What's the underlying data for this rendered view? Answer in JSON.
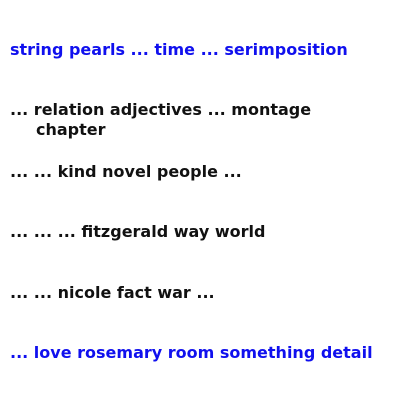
{
  "lines": [
    {
      "text": "string pearls ... time ... serimposition",
      "color": "#1010ee"
    },
    {
      "text": "... relation adjectives ... montage chapter",
      "color": "#111111"
    },
    {
      "text": "... ... kind novel people ...",
      "color": "#111111"
    },
    {
      "text": "... ... ... fitzgerald way world",
      "color": "#111111"
    },
    {
      "text": "... ... nicole fact war ...",
      "color": "#111111"
    },
    {
      "text": "... love rosemary room something detail",
      "color": "#1010ee"
    }
  ]
}
